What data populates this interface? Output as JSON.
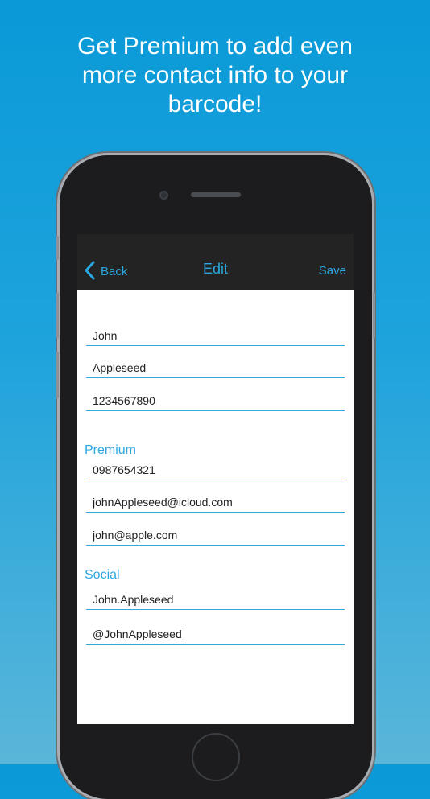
{
  "headline": {
    "line1": "Get Premium to add even",
    "line2": "more contact info to your",
    "line3": "barcode!"
  },
  "navbar": {
    "back_label": "Back",
    "title": "Edit",
    "save_label": "Save"
  },
  "fields": {
    "first_name": "John",
    "last_name": "Appleseed",
    "phone": "1234567890",
    "premium_label": "Premium",
    "premium_phone": "0987654321",
    "premium_email1": "johnAppleseed@icloud.com",
    "premium_email2": "john@apple.com",
    "social_label": "Social",
    "social_handle1": "John.Appleseed",
    "social_handle2": "@JohnAppleseed"
  },
  "colors": {
    "accent": "#2aa7e0",
    "navbar": "#232323",
    "background_top": "#0a9ad8",
    "background_bottom": "#5ab6d9"
  }
}
